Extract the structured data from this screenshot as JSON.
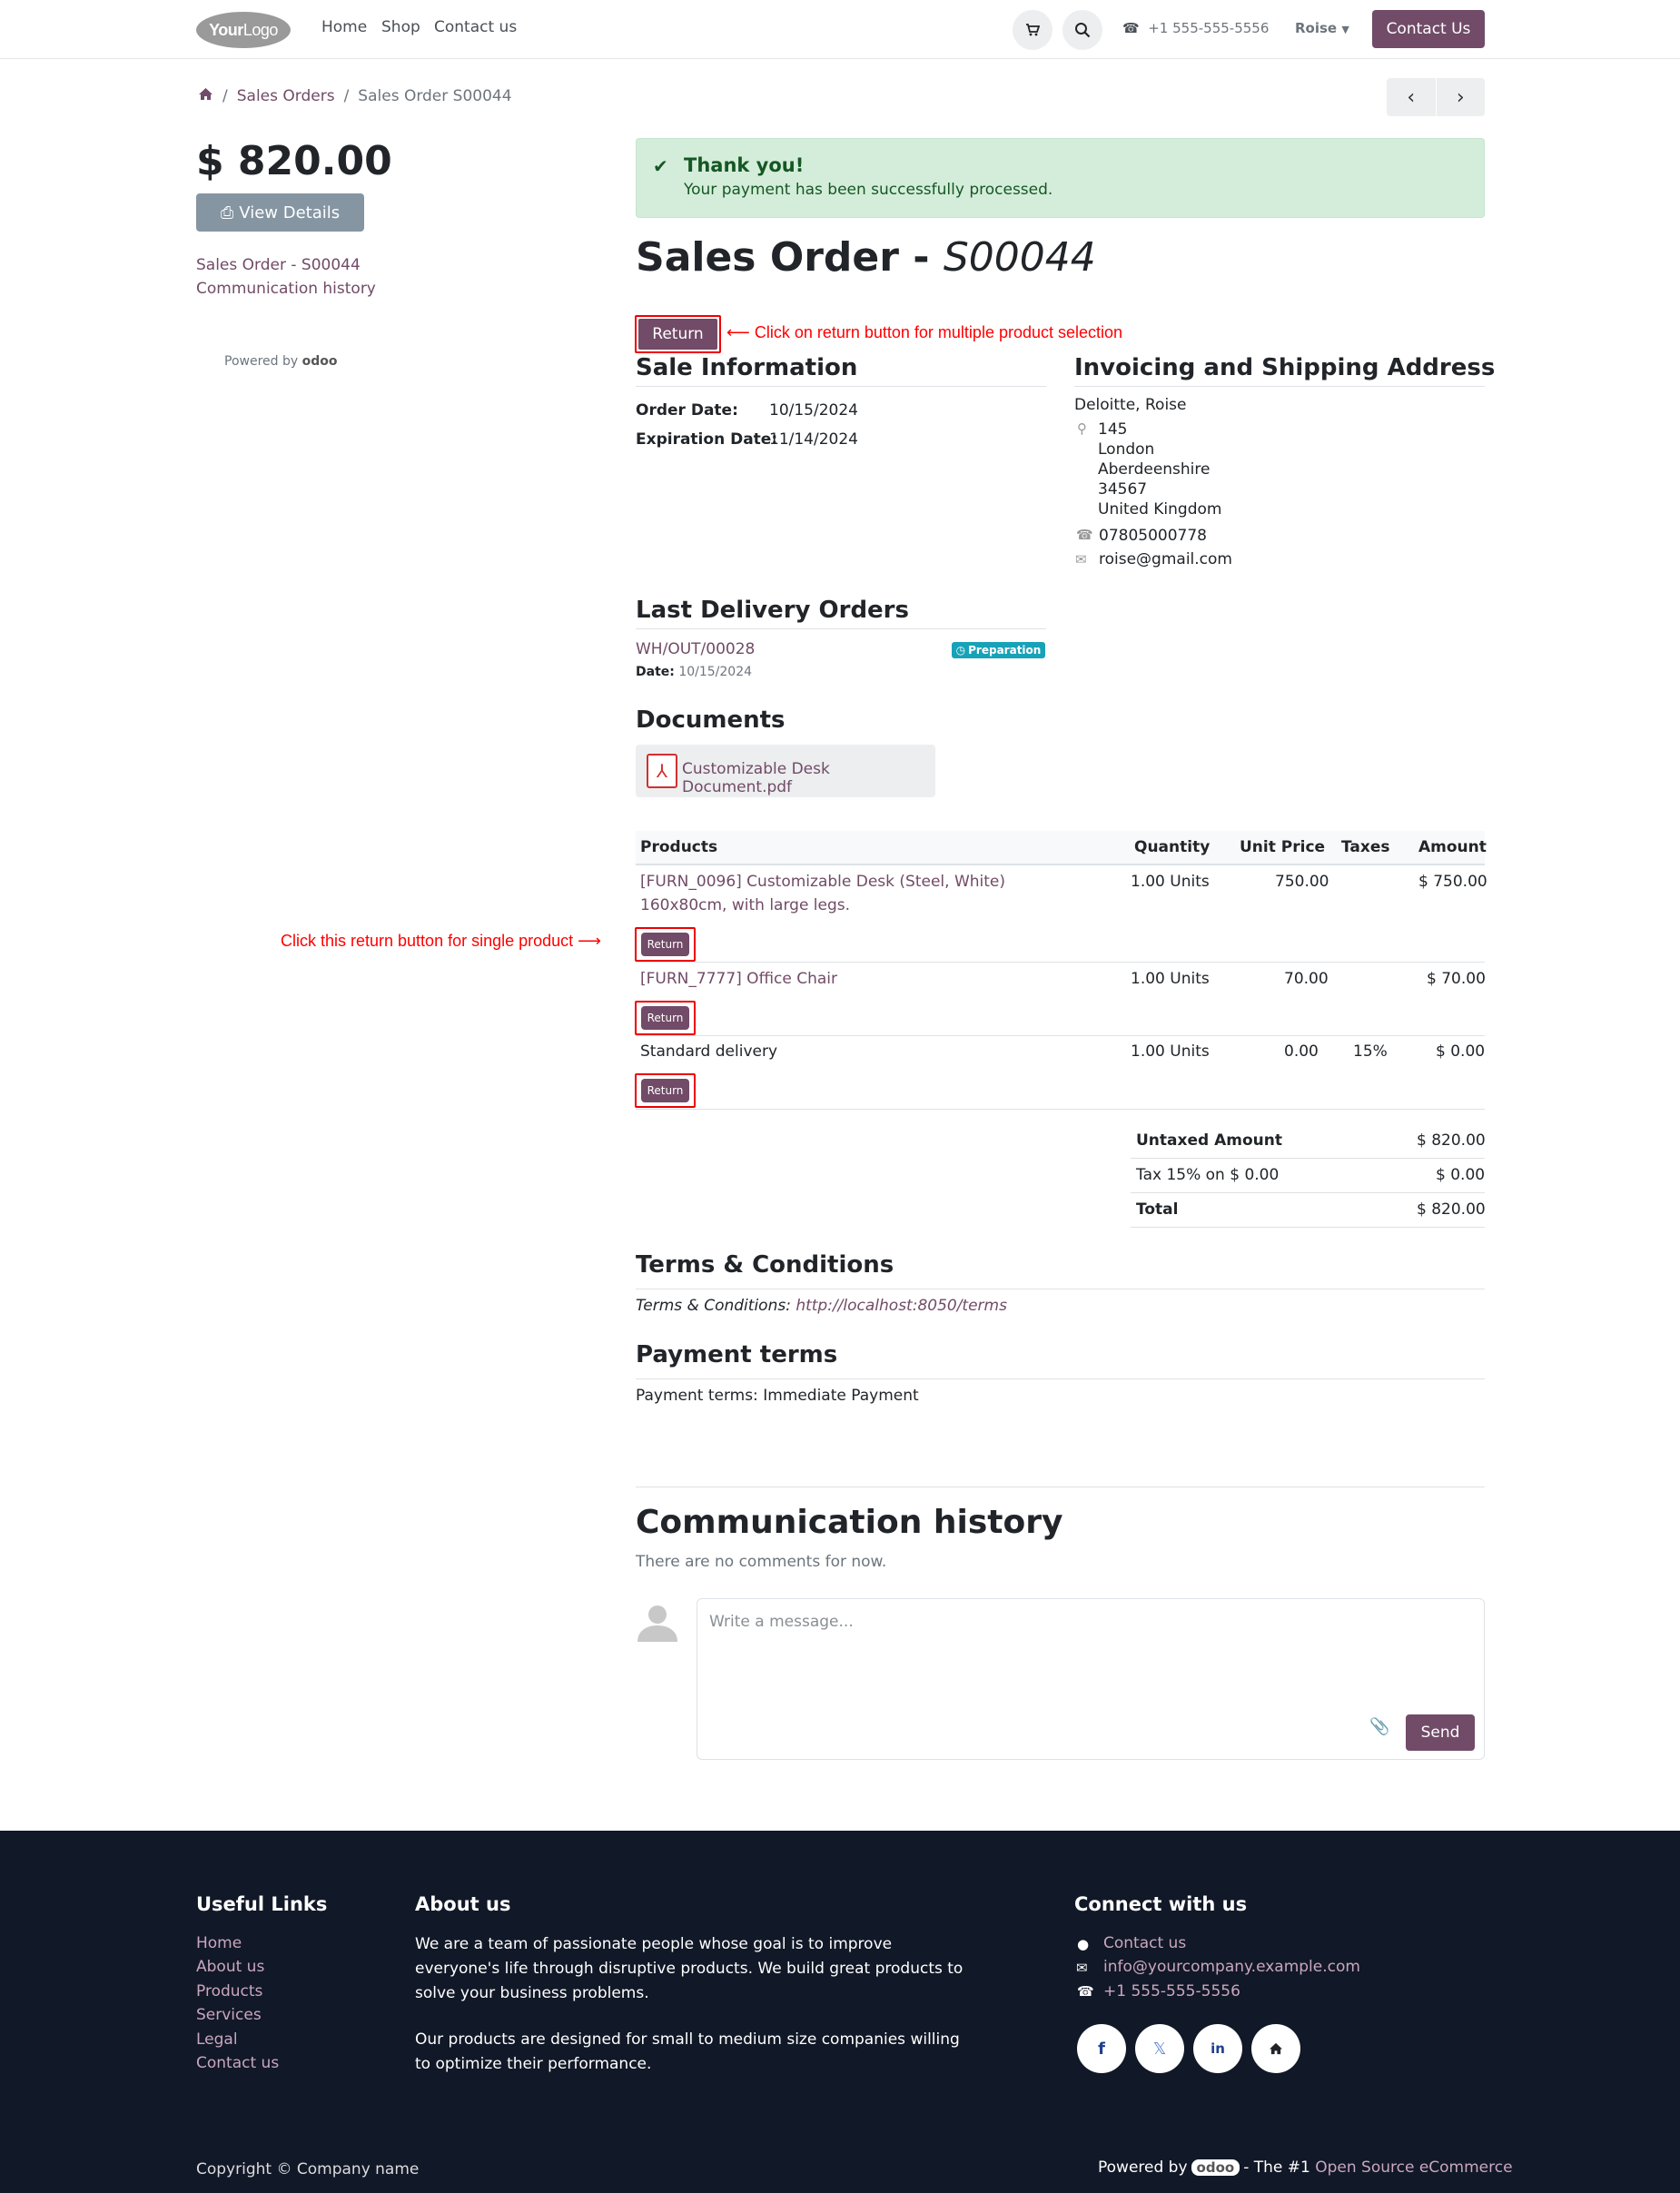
{
  "navbar": {
    "logo_a": "Your",
    "logo_b": "Logo",
    "links": [
      "Home",
      "Shop",
      "Contact us"
    ],
    "phone": "+1 555-555-5556",
    "user": "Roise",
    "contact_btn": "Contact Us"
  },
  "breadcrumb": {
    "home_icon": "home-icon",
    "item1": "Sales Orders",
    "item2": "Sales Order S00044"
  },
  "sidebar": {
    "amount": "$ 820.00",
    "view_details": "View Details",
    "links": [
      "Sales Order - S00044",
      "Communication history"
    ],
    "powered_by": "Powered by",
    "powered_brand": "odoo"
  },
  "alert": {
    "title": "Thank you!",
    "message": "Your payment has been successfully processed."
  },
  "order": {
    "title_prefix": "Sales Order - ",
    "title_id": "S00044",
    "return_label": "Return",
    "annotation_multi": "Click on return button for multiple product selection",
    "annotation_single": "Click this return button for single product"
  },
  "sale_info": {
    "heading": "Sale Information",
    "order_date_label": "Order Date:",
    "order_date": "10/15/2024",
    "expiration_label": "Expiration Date:",
    "expiration_date": "11/14/2024"
  },
  "address": {
    "heading": "Invoicing and Shipping Address",
    "name": "Deloitte, Roise",
    "lines": [
      "145",
      "London",
      "Aberdeenshire",
      "34567",
      "United Kingdom"
    ],
    "phone": "07805000778",
    "email": "roise@gmail.com"
  },
  "delivery": {
    "heading": "Last Delivery Orders",
    "ref": "WH/OUT/00028",
    "status": "Preparation",
    "date_label": "Date:",
    "date": "10/15/2024"
  },
  "documents": {
    "heading": "Documents",
    "file": "Customizable Desk Document.pdf"
  },
  "table": {
    "headers": [
      "Products",
      "Quantity",
      "Unit Price",
      "Taxes",
      "Amount"
    ],
    "rows": [
      {
        "product": "[FURN_0096] Customizable Desk (Steel, White)",
        "product2": "160x80cm, with large legs.",
        "qty": "1.00 Units",
        "price": "750.00",
        "taxes": "",
        "amount": "$ 750.00",
        "return": "Return"
      },
      {
        "product": "[FURN_7777] Office Chair",
        "product2": "",
        "qty": "1.00 Units",
        "price": "70.00",
        "taxes": "",
        "amount": "$ 70.00",
        "return": "Return"
      },
      {
        "product": "Standard delivery",
        "product2": "",
        "qty": "1.00 Units",
        "price": "0.00",
        "taxes": "15%",
        "amount": "$ 0.00",
        "return": "Return"
      }
    ]
  },
  "totals": {
    "untaxed_label": "Untaxed Amount",
    "untaxed": "$ 820.00",
    "tax_label": "Tax 15% on $ 0.00",
    "tax": "$ 0.00",
    "total_label": "Total",
    "total": "$ 820.00"
  },
  "terms": {
    "heading": "Terms & Conditions",
    "label": "Terms & Conditions:",
    "url": "http://localhost:8050/terms"
  },
  "payment": {
    "heading": "Payment terms",
    "text": "Payment terms: Immediate Payment"
  },
  "communication": {
    "heading": "Communication history",
    "empty": "There are no comments for now.",
    "placeholder": "Write a message...",
    "send": "Send"
  },
  "footer": {
    "useful_heading": "Useful Links",
    "useful_links": [
      "Home",
      "About us",
      "Products",
      "Services",
      "Legal",
      "Contact us"
    ],
    "about_heading": "About us",
    "about_p1": [
      "We are a team of passionate people whose goal is to improve",
      "everyone's life through disruptive products. We build great products to",
      "solve your business problems."
    ],
    "about_p2": [
      "Our products are designed for small to medium size companies willing",
      "to optimize their performance."
    ],
    "connect_heading": "Connect with us",
    "connect_links": [
      "Contact us",
      "info@yourcompany.example.com",
      "+1 555-555-5556"
    ],
    "copyright": "Copyright © Company name",
    "powered_by": "Powered by",
    "powered_brand": "odoo",
    "powered_mid": "- The #1",
    "powered_link": "Open Source eCommerce"
  },
  "colors": {
    "brand": "#714b67",
    "alert_bg": "#d4edda",
    "annotation": "#ff0000",
    "footer_bg": "#111827"
  }
}
